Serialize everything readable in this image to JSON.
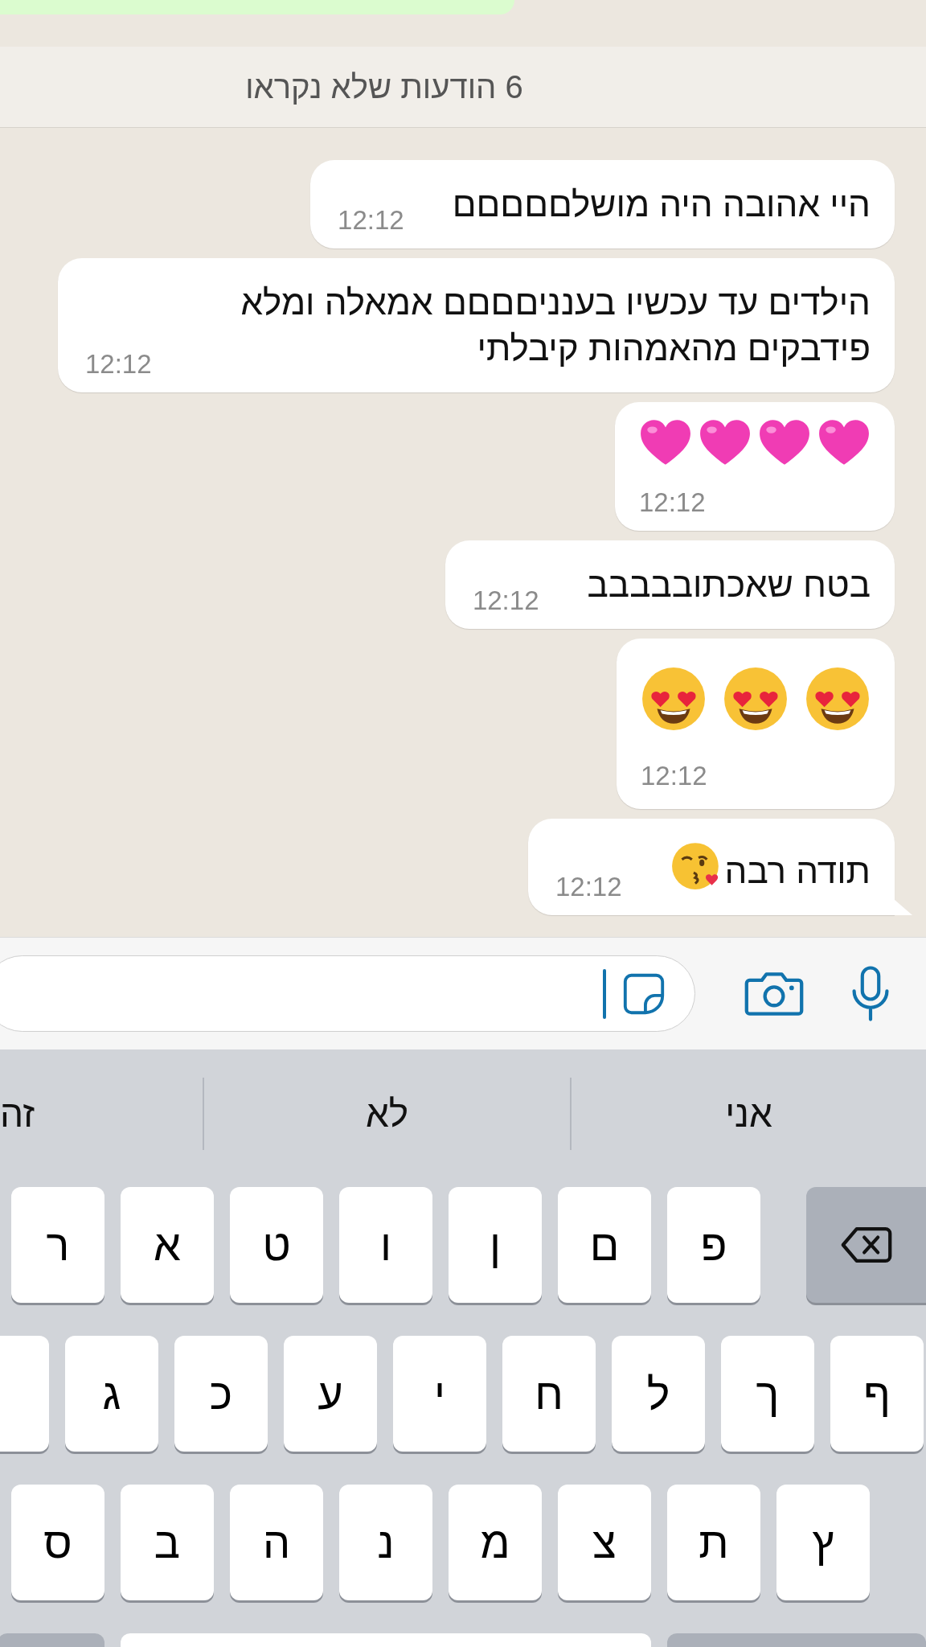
{
  "unread_banner": "6 הודעות שלא נקראו",
  "messages": [
    {
      "kind": "text",
      "text": "היי אהובה היה מושלםםםםם",
      "time": "12:12",
      "trailing_icon": false
    },
    {
      "kind": "text",
      "text": "הילדים עד עכשיו בענניםםםם אמאלה ומלא פידבקים מהאמהות קיבלתי",
      "time": "12:12",
      "trailing_icon": false
    },
    {
      "kind": "hearts",
      "time": "12:12"
    },
    {
      "kind": "text",
      "text": "בטח שאכתובבבבב",
      "time": "12:12",
      "trailing_icon": false
    },
    {
      "kind": "faces",
      "time": "12:12"
    },
    {
      "kind": "text",
      "text": "תודה רבה",
      "time": "12:12",
      "trailing_icon": true
    }
  ],
  "suggestions": [
    "אני",
    "לא",
    "זה"
  ],
  "keyboard_rows": [
    [
      {
        "kind": "backspace"
      },
      {
        "kind": "letter",
        "label": "פ"
      },
      {
        "kind": "letter",
        "label": "ם"
      },
      {
        "kind": "letter",
        "label": "ן"
      },
      {
        "kind": "letter",
        "label": "ו"
      },
      {
        "kind": "letter",
        "label": "ט"
      },
      {
        "kind": "letter",
        "label": "א"
      },
      {
        "kind": "letter",
        "label": "ר"
      }
    ],
    [
      {
        "kind": "letter",
        "label": "ף"
      },
      {
        "kind": "letter",
        "label": "ך"
      },
      {
        "kind": "letter",
        "label": "ל"
      },
      {
        "kind": "letter",
        "label": "ח"
      },
      {
        "kind": "letter",
        "label": "י"
      },
      {
        "kind": "letter",
        "label": "ע"
      },
      {
        "kind": "letter",
        "label": "כ"
      },
      {
        "kind": "letter",
        "label": "ג"
      },
      {
        "kind": "blank"
      }
    ],
    [
      {
        "kind": "letter",
        "label": "ץ"
      },
      {
        "kind": "letter",
        "label": "ת"
      },
      {
        "kind": "letter",
        "label": "צ"
      },
      {
        "kind": "letter",
        "label": "מ"
      },
      {
        "kind": "letter",
        "label": "נ"
      },
      {
        "kind": "letter",
        "label": "ה"
      },
      {
        "kind": "letter",
        "label": "ב"
      },
      {
        "kind": "letter",
        "label": "ס"
      }
    ],
    [
      {
        "kind": "function"
      },
      {
        "kind": "space"
      },
      {
        "kind": "function"
      }
    ]
  ]
}
